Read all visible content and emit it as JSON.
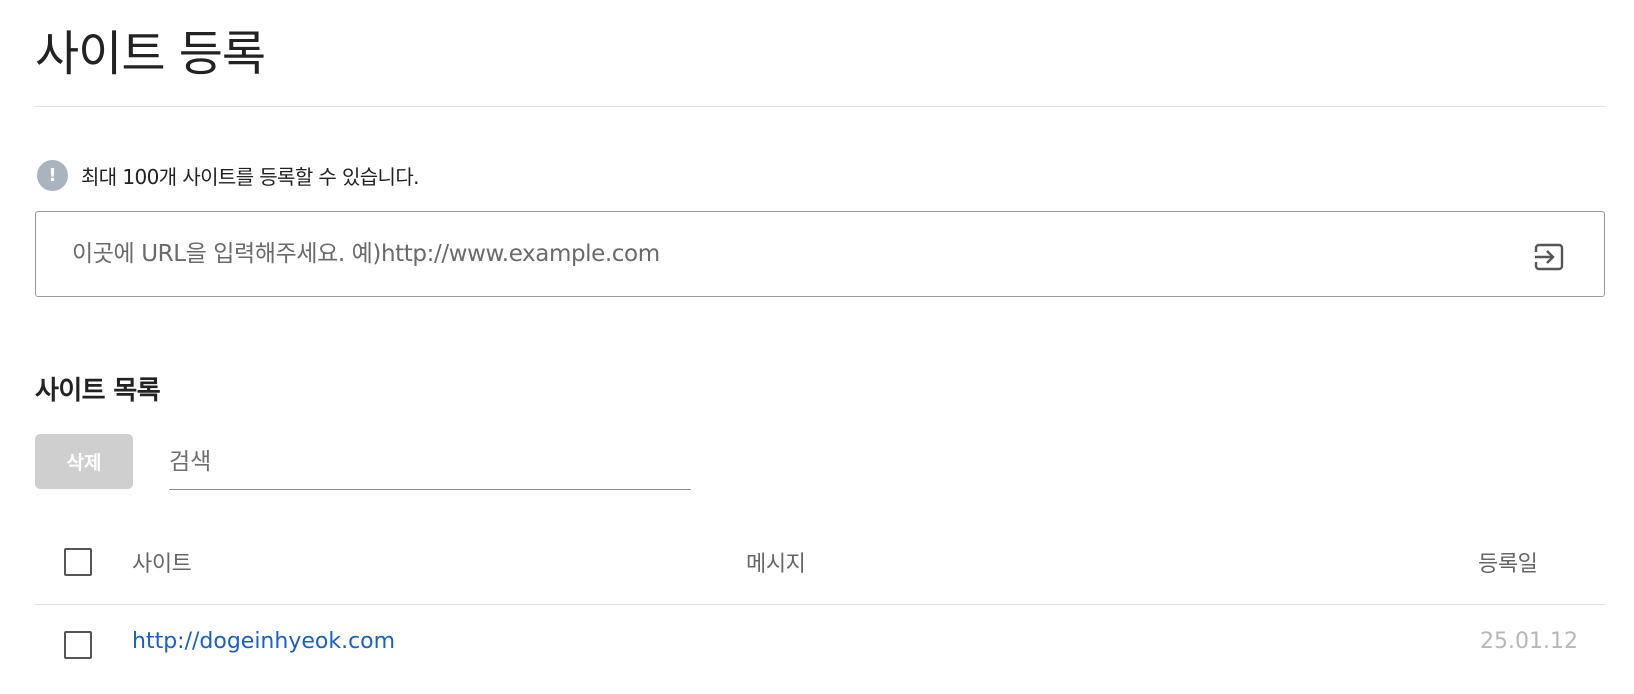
{
  "header": {
    "title": "사이트 등록"
  },
  "notice": {
    "icon": "exclamation-icon",
    "icon_glyph": "!",
    "text": "최대 100개 사이트를 등록할 수 있습니다."
  },
  "url_input": {
    "value": "",
    "placeholder": "이곳에 URL을 입력해주세요. 예)http://www.example.com",
    "submit_icon": "enter-arrow-icon"
  },
  "site_list": {
    "title": "사이트 목록",
    "delete_label": "삭제",
    "search": {
      "value": "",
      "placeholder": "검색"
    },
    "columns": [
      "사이트",
      "메시지",
      "등록일"
    ],
    "rows": [
      {
        "site": "http://dogeinhyeok.com",
        "message": "",
        "date": "25.01.12",
        "checked": false
      }
    ]
  },
  "colors": {
    "link": "#1a5fc8",
    "notice_icon_bg": "#a8b4c0",
    "delete_button_bg": "#cfcfcf",
    "date_text": "#b7b7b7"
  }
}
